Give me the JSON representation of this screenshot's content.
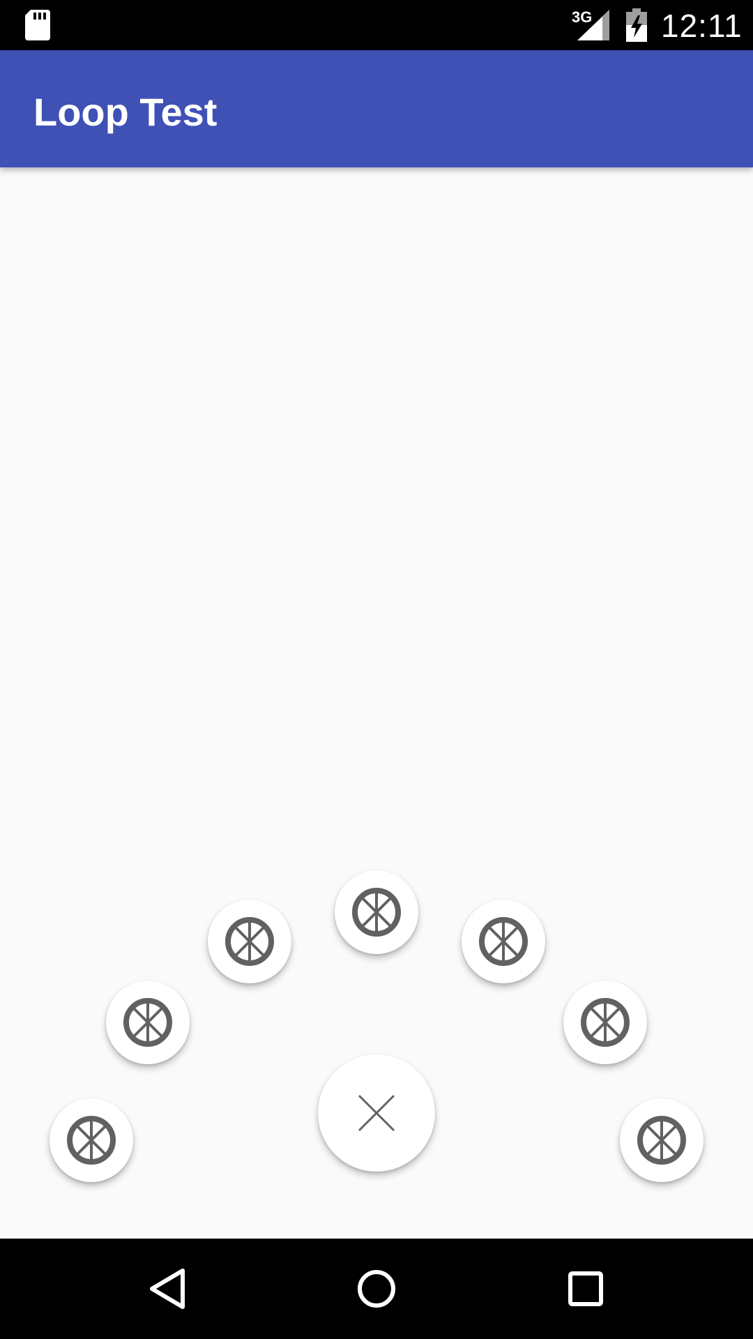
{
  "status_bar": {
    "network_type": "3G",
    "time": "12:11",
    "icons": [
      "sd-card-icon",
      "signal-icon",
      "battery-charging-icon"
    ]
  },
  "app_bar": {
    "title": "Loop Test",
    "color": "#3f51b5"
  },
  "fab_menu": {
    "items": [
      {
        "icon": "wheel-icon"
      },
      {
        "icon": "wheel-icon"
      },
      {
        "icon": "wheel-icon"
      },
      {
        "icon": "wheel-icon"
      },
      {
        "icon": "wheel-icon"
      },
      {
        "icon": "wheel-icon"
      },
      {
        "icon": "wheel-icon"
      }
    ],
    "main_icon": "close-icon",
    "icon_color": "#616161"
  },
  "nav_bar": {
    "buttons": [
      "back-icon",
      "home-icon",
      "recents-icon"
    ]
  }
}
